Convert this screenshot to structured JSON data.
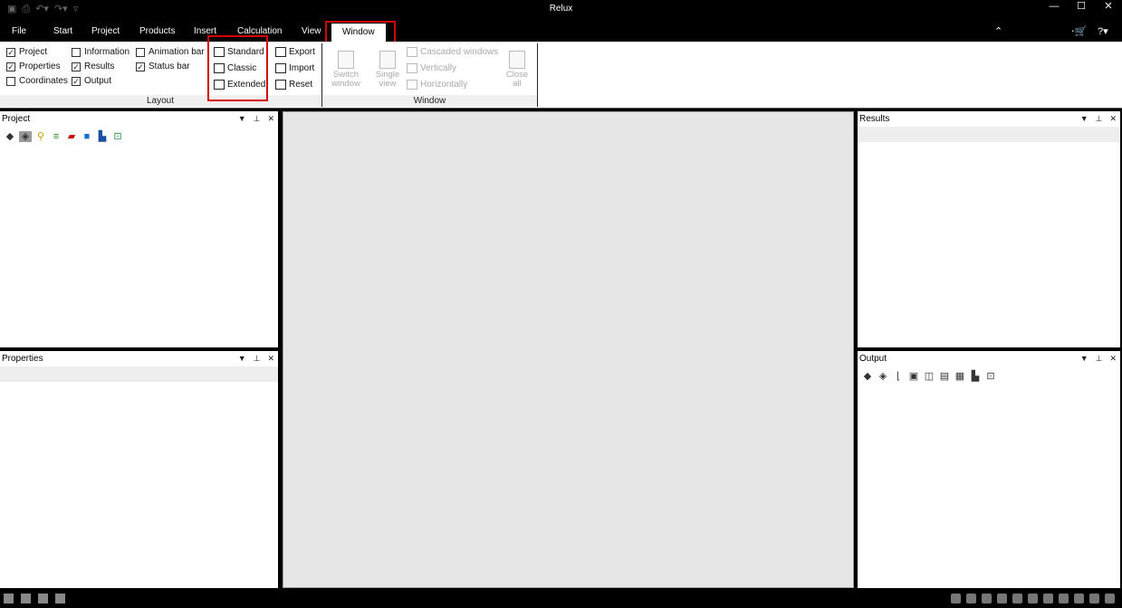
{
  "window": {
    "title": "Relux"
  },
  "menu": {
    "tabs": [
      {
        "label": "File"
      },
      {
        "label": "Start"
      },
      {
        "label": "Project"
      },
      {
        "label": "Products"
      },
      {
        "label": "Insert"
      },
      {
        "label": "Calculation"
      },
      {
        "label": "View"
      },
      {
        "label": "Window"
      }
    ],
    "active_tab": "Window"
  },
  "ribbon": {
    "layout_group": {
      "label": "Layout",
      "checkboxes": [
        {
          "label": "Project",
          "checked": true
        },
        {
          "label": "Properties",
          "checked": true
        },
        {
          "label": "Coordinates",
          "checked": false
        },
        {
          "label": "Information",
          "checked": false
        },
        {
          "label": "Results",
          "checked": true
        },
        {
          "label": "Output",
          "checked": true
        },
        {
          "label": "Animation bar",
          "checked": false
        },
        {
          "label": "Status bar",
          "checked": true
        }
      ],
      "layout_buttons": [
        {
          "label": "Standard"
        },
        {
          "label": "Classic"
        },
        {
          "label": "Extended"
        }
      ],
      "io_buttons": [
        {
          "label": "Export"
        },
        {
          "label": "Import"
        },
        {
          "label": "Reset"
        }
      ]
    },
    "window_group": {
      "label": "Window",
      "switch_window": {
        "line1": "Switch",
        "line2": "window"
      },
      "single_view": {
        "line1": "Single",
        "line2": "view"
      },
      "arrange": [
        {
          "label": "Cascaded windows"
        },
        {
          "label": "Vertically"
        },
        {
          "label": "Horizontally"
        }
      ],
      "close_all": {
        "line1": "Close",
        "line2": "all"
      }
    }
  },
  "panels": {
    "project": {
      "title": "Project"
    },
    "properties": {
      "title": "Properties"
    },
    "results": {
      "title": "Results"
    },
    "output": {
      "title": "Output"
    }
  },
  "colors": {
    "highlight": "#d40000",
    "chrome": "#000000",
    "workspace": "#e6e6e6"
  }
}
